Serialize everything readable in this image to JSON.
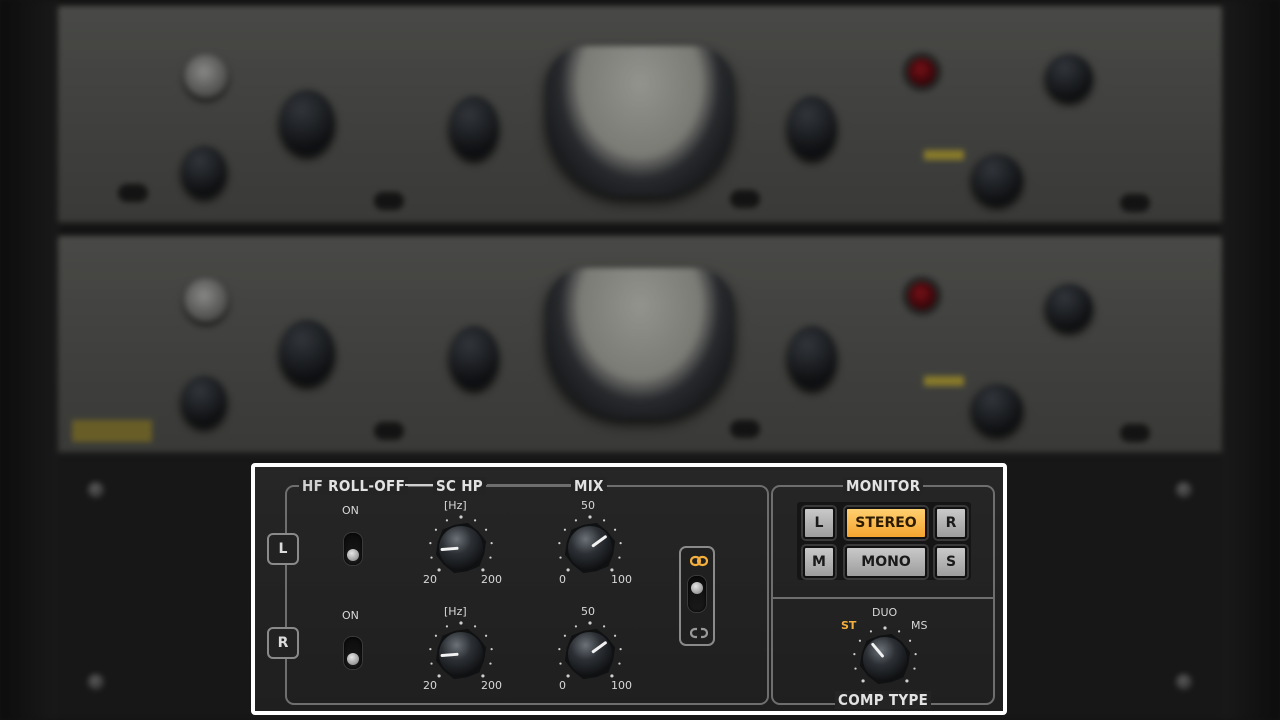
{
  "panel": {
    "sections": {
      "hf_rolloff": "HF",
      "hf_rolloff_b": "ROLL-OFF",
      "sc_hp": "SC HP",
      "mix": "MIX",
      "monitor": "MONITOR",
      "comp_type": "COMP TYPE"
    },
    "channels": [
      {
        "button": "L",
        "toggle_label": "ON",
        "sc_hp": {
          "unit": "[Hz]",
          "min": "20",
          "max": "200",
          "value_fraction": 0.15
        },
        "mix": {
          "top": "50",
          "min": "0",
          "max": "100",
          "value_fraction": 0.7
        }
      },
      {
        "button": "R",
        "toggle_label": "ON",
        "sc_hp": {
          "unit": "[Hz]",
          "min": "20",
          "max": "200",
          "value_fraction": 0.15
        },
        "mix": {
          "top": "50",
          "min": "0",
          "max": "100",
          "value_fraction": 0.7
        }
      }
    ],
    "link": {
      "icon_top": "link-icon",
      "icon_bottom": "unlink-icon"
    },
    "monitor": {
      "row1": [
        "L",
        "STEREO",
        "R"
      ],
      "row2": [
        "M",
        "MONO",
        "S"
      ],
      "active": "STEREO"
    },
    "comp_type": {
      "options": [
        "ST",
        "DUO",
        "MS"
      ],
      "active": "ST"
    },
    "colors": {
      "accent": "#f4b03e",
      "highlight_border": "#ffffff",
      "panel_bg": "#242424"
    }
  }
}
